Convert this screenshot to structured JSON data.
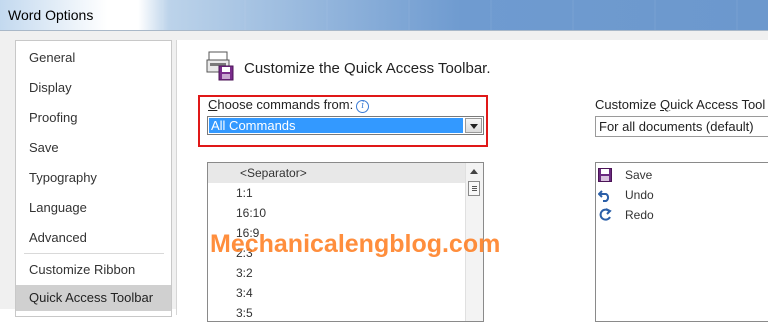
{
  "window": {
    "title": "Word Options"
  },
  "nav": {
    "items": [
      {
        "label": "General"
      },
      {
        "label": "Display"
      },
      {
        "label": "Proofing"
      },
      {
        "label": "Save"
      },
      {
        "label": "Typography"
      },
      {
        "label": "Language"
      },
      {
        "label": "Advanced"
      },
      {
        "label": "Customize Ribbon"
      },
      {
        "label": "Quick Access Toolbar"
      }
    ],
    "selected": "Quick Access Toolbar"
  },
  "main": {
    "heading": "Customize the Quick Access Toolbar.",
    "choose_label_prefix": "C",
    "choose_label_rest": "hoose commands from:",
    "info_icon_glyph": "i",
    "commands_dropdown_value": "All Commands",
    "customize_label_prefix": "Customize ",
    "customize_label_underline": "Q",
    "customize_label_rest": "uick Access Tool",
    "scope_dropdown_value": "For all documents (default)",
    "commands": [
      "<Separator>",
      "1:1",
      "16:10",
      "16:9",
      "2:3",
      "3:2",
      "3:4",
      "3:5"
    ],
    "qat_items": [
      {
        "label": "Save",
        "icon": "save-icon"
      },
      {
        "label": "Undo",
        "icon": "undo-icon"
      },
      {
        "label": "Redo",
        "icon": "redo-icon"
      }
    ]
  },
  "watermark": {
    "text": "Mechanicalengblog.com"
  },
  "colors": {
    "highlight_border": "#e01818",
    "selection_bg": "#3399ff",
    "watermark": "#ff7b1c",
    "nav_selected_bg": "#d0d0d0"
  }
}
